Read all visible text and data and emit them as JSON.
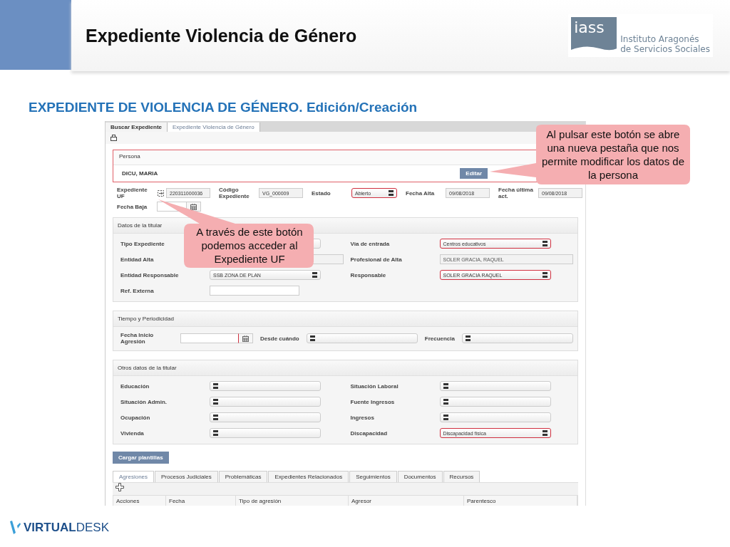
{
  "slide": {
    "title": "Expediente Violencia de Género",
    "logo": {
      "mark": "iass",
      "lines": [
        "Instituto Aragonés",
        "de Servicios Sociales"
      ]
    },
    "subtitle": "EXPEDIENTE DE VIOLENCIA DE GÉNERO. Edición/Creación",
    "footer_logo": "**VIRTUAL**DESK"
  },
  "app": {
    "tabs": [
      {
        "label": "Buscar Expediente",
        "selected": false
      },
      {
        "label": "Expediente Violencia de Género",
        "selected": true
      }
    ],
    "persona": {
      "heading": "Persona",
      "name": "DICU, MARIA",
      "edit_button": "Editar"
    },
    "header_rows": [
      [
        {
          "label": "Expediente UF",
          "kind": "link",
          "value": "220311000036"
        },
        {
          "label": "Código Expediente",
          "kind": "readonly",
          "value": "VG_000009"
        },
        {
          "label": "Estado",
          "kind": "select",
          "value": "Abierto",
          "required": true
        },
        {
          "label": "Fecha Alta",
          "kind": "readonly",
          "value": "09/08/2018"
        },
        {
          "label": "Fecha última act.",
          "kind": "readonly",
          "value": "09/08/2018"
        }
      ],
      [
        {
          "label": "Fecha Baja",
          "kind": "date"
        }
      ]
    ],
    "sections": [
      {
        "heading": "Datos de la titular",
        "fields": [
          {
            "label": "Tipo Expediente",
            "kind": "select"
          },
          {
            "label": "Vía de entrada",
            "kind": "select",
            "value": "Centros educativos",
            "required": true
          },
          {
            "label": "Entidad Alta",
            "kind": "readonly"
          },
          {
            "label": "Profesional de Alta",
            "kind": "readonly",
            "value": "SOLER GRACIA, RAQUEL"
          },
          {
            "label": "Entidad Responsable",
            "kind": "select",
            "value": "SSB ZONA DE PLAN",
            "required": false
          },
          {
            "label": "Responsable",
            "kind": "select",
            "value": "SOLER GRACIA RAQUEL",
            "required": true
          },
          {
            "label": "Ref. Externa",
            "kind": "input"
          }
        ]
      },
      {
        "heading": "Tiempo y Periodicidad",
        "fields": [
          {
            "label": "Fecha Inicio Agresión",
            "kind": "date",
            "required": true
          },
          {
            "label": "Desde cuándo",
            "kind": "select",
            "required": false
          },
          {
            "label": "Frecuencia",
            "kind": "select",
            "required": false
          }
        ]
      },
      {
        "heading": "Otros datos de la titular",
        "fields": [
          {
            "label": "Educación",
            "kind": "select",
            "required": false
          },
          {
            "label": "Situación Laboral",
            "kind": "select",
            "required": false
          },
          {
            "label": "Situación Admin.",
            "kind": "select",
            "required": false
          },
          {
            "label": "Fuente Ingresos",
            "kind": "select",
            "required": false
          },
          {
            "label": "Ocupación",
            "kind": "select",
            "required": false
          },
          {
            "label": "Ingresos",
            "kind": "select",
            "required": false
          },
          {
            "label": "Vivienda",
            "kind": "select",
            "required": false
          },
          {
            "label": "Discapacidad",
            "kind": "select",
            "value": "Discapacidad física",
            "required": true
          }
        ]
      }
    ],
    "template_button": "Cargar plantillas",
    "detail_tabs": [
      {
        "label": "Agresiones",
        "selected": true
      },
      {
        "label": "Procesos Judiciales",
        "selected": false
      },
      {
        "label": "Problemáticas",
        "selected": false
      },
      {
        "label": "Expedientes Relacionados",
        "selected": false
      },
      {
        "label": "Seguimientos",
        "selected": false
      },
      {
        "label": "Documentos",
        "selected": false
      },
      {
        "label": "Recursos",
        "selected": false
      }
    ],
    "table": {
      "columns": [
        "Acciones",
        "Fecha",
        "Tipo de agresión",
        "Agresor",
        "Parentesco"
      ]
    }
  },
  "callouts": [
    {
      "text": "Al pulsar este botón se abre una nueva pestaña que nos permite modificar los datos de la persona"
    },
    {
      "text": "A través de este botón podemos acceder al Expediente UF"
    }
  ]
}
